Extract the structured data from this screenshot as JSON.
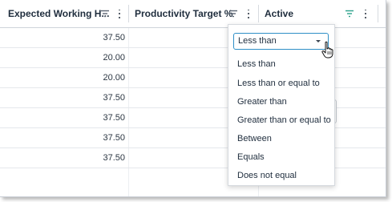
{
  "columns": [
    {
      "title": "Expected Working H..."
    },
    {
      "title": "Productivity Target %"
    },
    {
      "title": "Active"
    }
  ],
  "rows": [
    {
      "expected_hours": "37.50"
    },
    {
      "expected_hours": "20.00"
    },
    {
      "expected_hours": "20.00"
    },
    {
      "expected_hours": "37.50"
    },
    {
      "expected_hours": "37.50"
    },
    {
      "expected_hours": "37.50"
    },
    {
      "expected_hours": "37.50"
    }
  ],
  "filter_popup": {
    "selected": "Less than",
    "options": [
      "Less than",
      "Less than or equal to",
      "Greater than",
      "Greater than or equal to",
      "Between",
      "Equals",
      "Does not equal"
    ]
  },
  "colors": {
    "active_filter": "#2aa28a",
    "select_border": "#2f8fc7"
  }
}
